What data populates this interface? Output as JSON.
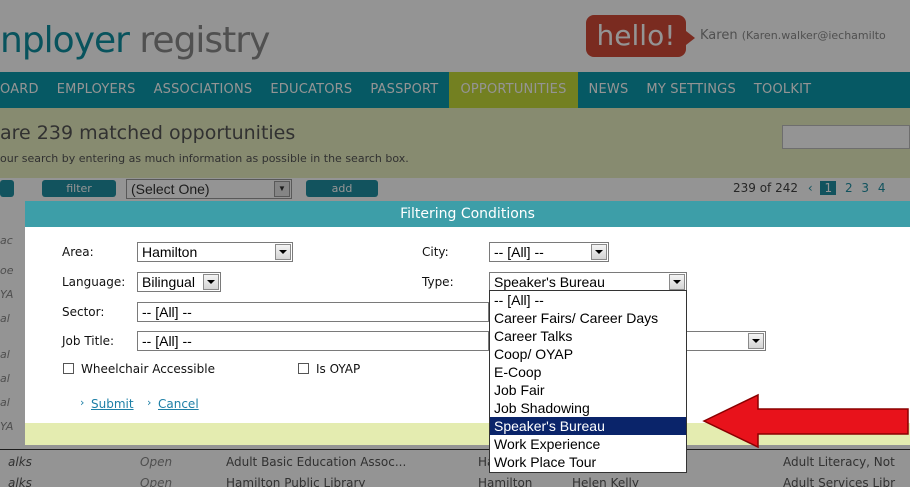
{
  "header": {
    "logo_part1": "nployer",
    "logo_part2": "registry",
    "greeting": "hello!",
    "user_name": "Karen",
    "user_email": "(Karen.walker@iechamilto"
  },
  "nav": {
    "items": [
      {
        "label": "OARD",
        "active": false
      },
      {
        "label": "EMPLOYERS",
        "active": false
      },
      {
        "label": "ASSOCIATIONS",
        "active": false
      },
      {
        "label": "EDUCATORS",
        "active": false
      },
      {
        "label": "PASSPORT",
        "active": false
      },
      {
        "label": "OPPORTUNITIES",
        "active": true
      },
      {
        "label": "NEWS",
        "active": false
      },
      {
        "label": "MY SETTINGS",
        "active": false
      },
      {
        "label": "TOOLKIT",
        "active": false
      }
    ]
  },
  "banner": {
    "title": "are 239 matched opportunities",
    "subtitle": "our search by entering as much information as possible in the search box."
  },
  "toolbar": {
    "filter_label": "filter",
    "select_value": "(Select One)",
    "add_label": "add",
    "pager_count": "239 of 242",
    "pager_prev": "‹",
    "pages": [
      "1",
      "2",
      "3",
      "4"
    ]
  },
  "left_column_fragments": [
    "ac",
    "oe",
    "YA",
    "al",
    "al",
    "al",
    "al",
    "YA"
  ],
  "dialog": {
    "title": "Filtering Conditions",
    "area_label": "Area:",
    "area_value": "Hamilton",
    "city_label": "City:",
    "city_value": "-- [All] --",
    "language_label": "Language:",
    "language_value": "Bilingual",
    "type_label": "Type:",
    "type_value": "Speaker's Bureau",
    "sector_label": "Sector:",
    "sector_value": "-- [All] --",
    "jobtitle_label": "Job Title:",
    "jobtitle_value": "-- [All] --",
    "wheelchair_label": "Wheelchair Accessible",
    "oyap_label": "Is OYAP",
    "submit_label": "Submit",
    "cancel_label": "Cancel"
  },
  "type_options": [
    {
      "label": "-- [All] --",
      "selected": false
    },
    {
      "label": "Career Fairs/ Career Days",
      "selected": false
    },
    {
      "label": "Career Talks",
      "selected": false
    },
    {
      "label": "Coop/ OYAP",
      "selected": false
    },
    {
      "label": "E-Coop",
      "selected": false
    },
    {
      "label": "Job Fair",
      "selected": false
    },
    {
      "label": "Job Shadowing",
      "selected": false
    },
    {
      "label": "Speaker's Bureau",
      "selected": true
    },
    {
      "label": "Work Experience",
      "selected": false
    },
    {
      "label": "Work Place Tour",
      "selected": false
    }
  ],
  "bottom_rows": [
    {
      "c1": "alks",
      "c2": "Open",
      "c3": "Adult Basic Education Assoc...",
      "c4": "Ha",
      "c5": "",
      "c6": "Adult Literacy, Not"
    },
    {
      "c1": "alks",
      "c2": "Open",
      "c3": "Hamilton Public Library",
      "c4": "Hamilton",
      "c5": "Helen Kelly",
      "c6": "Adult Services Libr"
    }
  ],
  "colors": {
    "nav_bg": "#0c9aac",
    "nav_active": "#c7dd3a",
    "dialog_title_bg": "#3d9ea8",
    "selection": "#0a246a",
    "arrow": "#e8121b"
  }
}
